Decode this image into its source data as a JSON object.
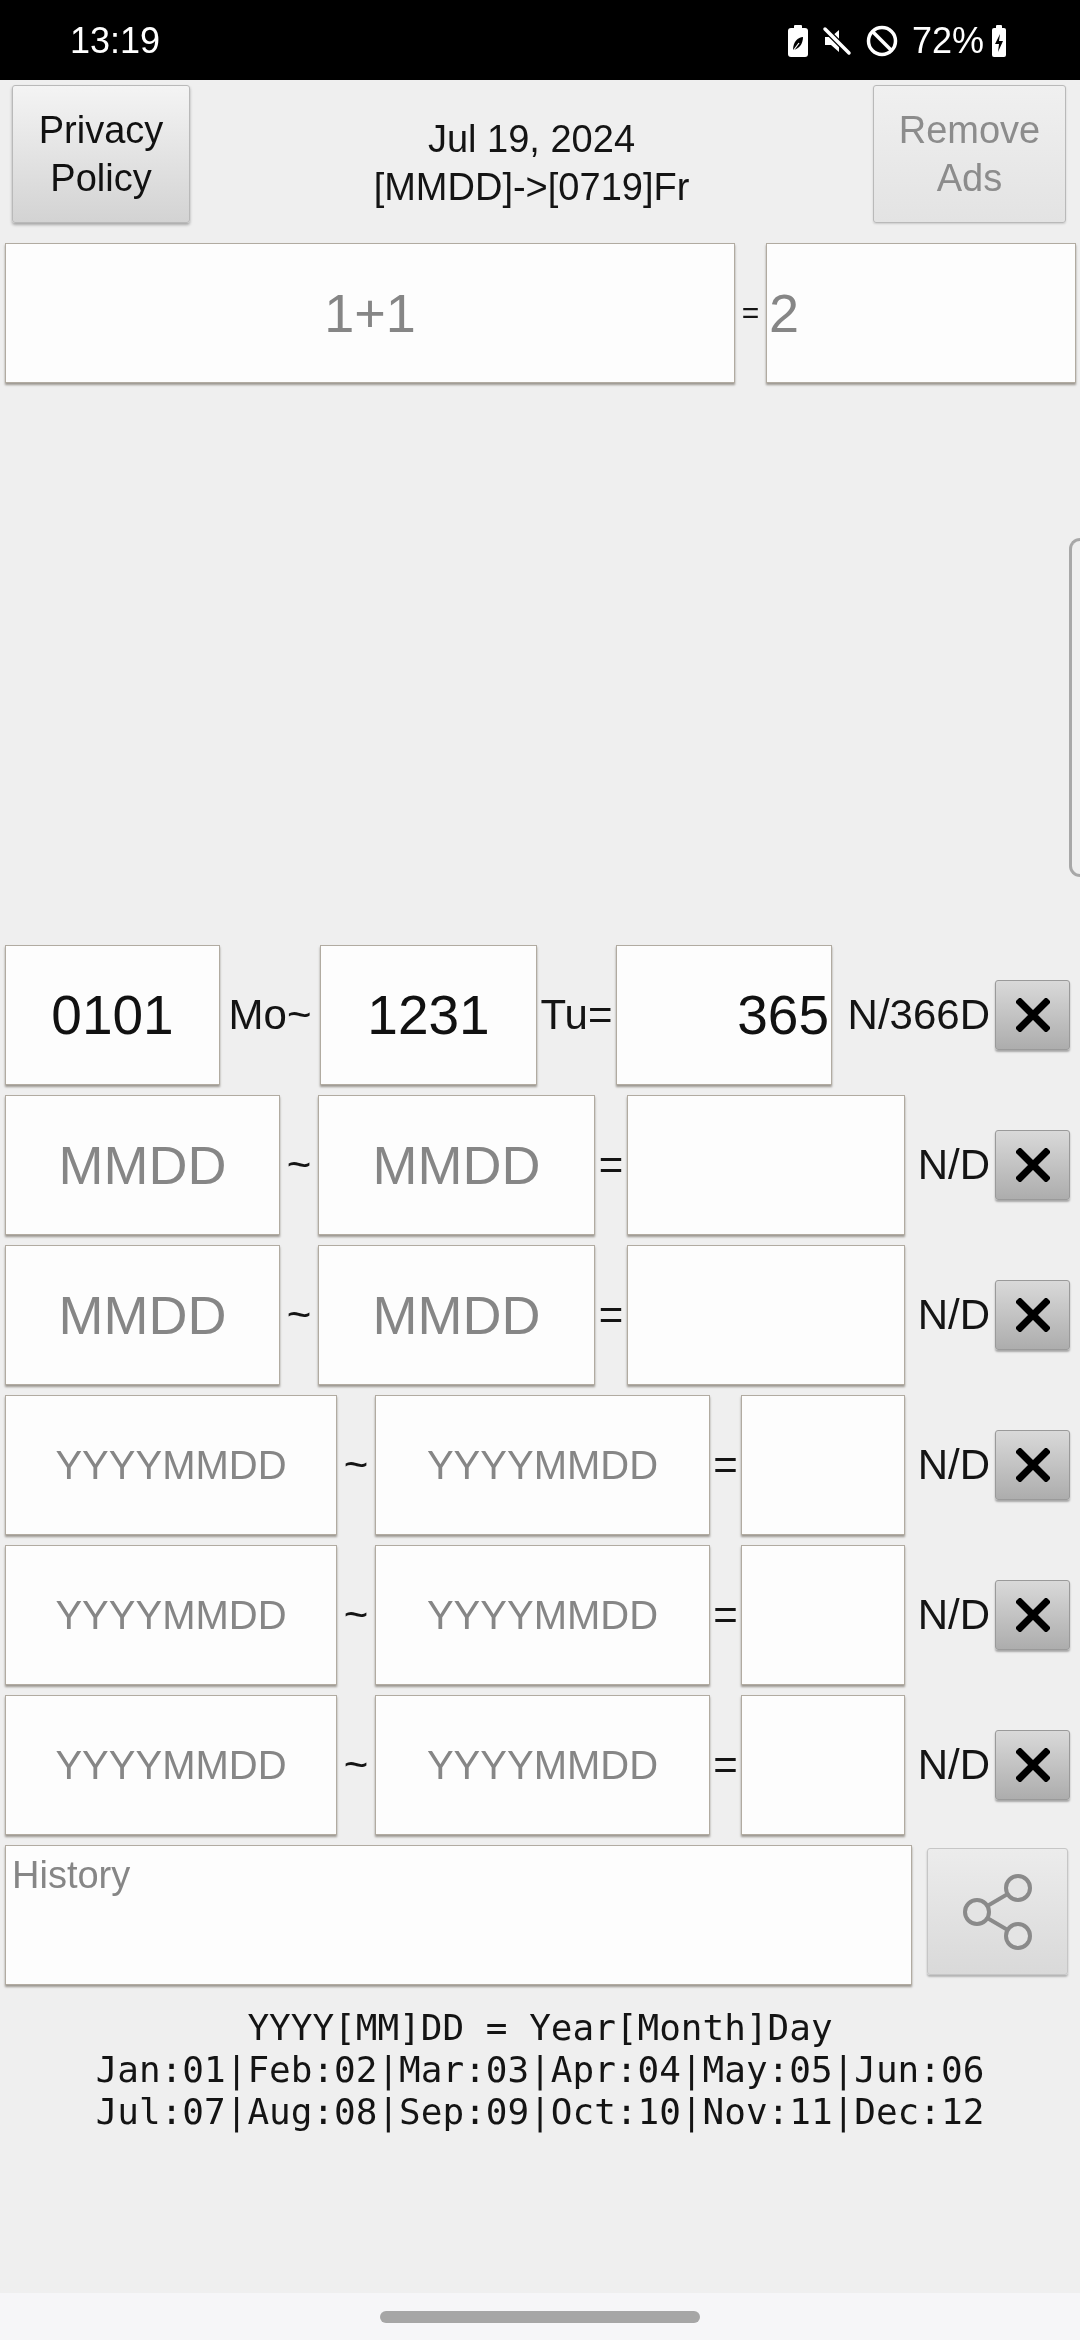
{
  "status_bar": {
    "time": "13:19",
    "battery": "72%"
  },
  "header": {
    "privacy_button": {
      "label": "Privacy Policy",
      "disabled": false
    },
    "date": "Jul 19, 2024",
    "date_code": "[MMDD]->[0719]Fr",
    "remove_ads_button": {
      "label": "Remove Ads",
      "disabled": true
    }
  },
  "calculator": {
    "expression": {
      "placeholder": "1+1"
    },
    "equals": "=",
    "result": {
      "placeholder": "2"
    }
  },
  "ranges": [
    {
      "kind": "day_of_year",
      "from": {
        "value": "0101"
      },
      "separator": "Mo~",
      "to": {
        "value": "1231"
      },
      "equals": "Tu=",
      "result": {
        "value": "365"
      },
      "unit": "N/366D"
    },
    {
      "kind": "mmdd",
      "from": {
        "placeholder": "MMDD"
      },
      "separator": "~",
      "to": {
        "placeholder": "MMDD"
      },
      "equals": "=",
      "unit": "N/D"
    },
    {
      "kind": "mmdd",
      "from": {
        "placeholder": "MMDD"
      },
      "separator": "~",
      "to": {
        "placeholder": "MMDD"
      },
      "equals": "=",
      "unit": "N/D"
    },
    {
      "kind": "yyyymmdd",
      "from": {
        "placeholder": "YYYYMMDD"
      },
      "separator": "~",
      "to": {
        "placeholder": "YYYYMMDD"
      },
      "equals": "=",
      "unit": "N/D"
    },
    {
      "kind": "yyyymmdd",
      "from": {
        "placeholder": "YYYYMMDD"
      },
      "separator": "~",
      "to": {
        "placeholder": "YYYYMMDD"
      },
      "equals": "=",
      "unit": "N/D"
    },
    {
      "kind": "yyyymmdd",
      "from": {
        "placeholder": "YYYYMMDD"
      },
      "separator": "~",
      "to": {
        "placeholder": "YYYYMMDD"
      },
      "equals": "=",
      "unit": "N/D"
    }
  ],
  "history": {
    "placeholder": "History"
  },
  "legend": [
    "YYYY[MM]DD = Year[Month]Day",
    "Jan:01|Feb:02|Mar:03|Apr:04|May:05|Jun:06",
    "Jul:07|Aug:08|Sep:09|Oct:10|Nov:11|Dec:12"
  ]
}
